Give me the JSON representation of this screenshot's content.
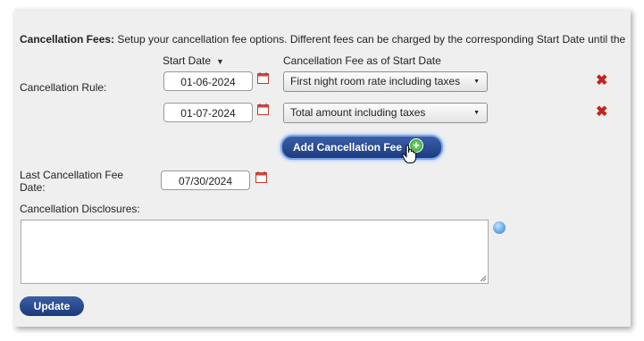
{
  "intro": {
    "label": "Cancellation Fees:",
    "text": " Setup your cancellation fee options. Different fees can be charged by the corresponding Start Date until the"
  },
  "headers": {
    "start_date": "Start Date",
    "fee": "Cancellation Fee as of Start Date"
  },
  "cancellation_rule_label": "Cancellation Rule:",
  "rules": [
    {
      "start_date": "01-06-2024",
      "fee": "First night room rate including taxes"
    },
    {
      "start_date": "01-07-2024",
      "fee": "Total amount including taxes"
    }
  ],
  "add_fee_button": "Add Cancellation Fee",
  "last_fee_date": {
    "label_line1": "Last Cancellation Fee",
    "label_line2": "Date:",
    "value": "07/30/2024"
  },
  "disclosures_label": "Cancellation Disclosures:",
  "update_button": "Update",
  "colors": {
    "delete": "#c4231c",
    "button": "#1d3c80",
    "panel": "#efefef"
  }
}
